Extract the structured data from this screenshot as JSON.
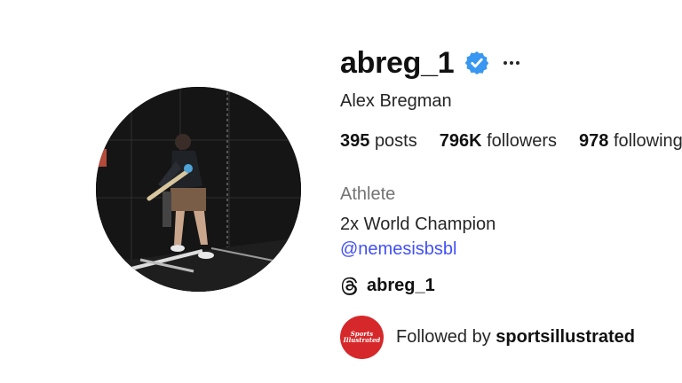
{
  "profile": {
    "username": "abreg_1",
    "full_name": "Alex Bregman",
    "verified_icon": "verified-badge-icon",
    "verified_color": "#3897f0",
    "more_icon": "more-options-icon"
  },
  "stats": {
    "posts_count": "395",
    "posts_label": "posts",
    "followers_count": "796K",
    "followers_label": "followers",
    "following_count": "978",
    "following_label": "following"
  },
  "bio": {
    "category": "Athlete",
    "text": "2x World Champion",
    "mention": "@nemesisbsbl",
    "mention_color": "#4150f7"
  },
  "threads": {
    "icon": "threads-icon",
    "handle": "abreg_1"
  },
  "followed_by": {
    "prefix": "Followed by",
    "account": "sportsillustrated",
    "logo_line1": "Sports",
    "logo_line2": "Illustrated",
    "logo_color": "#d6282a"
  }
}
